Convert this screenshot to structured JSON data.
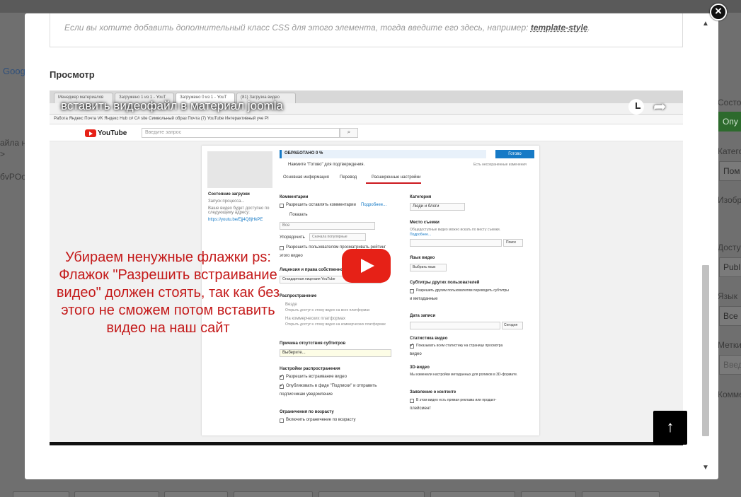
{
  "background": {
    "left_texts": [
      "Goog",
      "айла н",
      ">",
      "бvPOow"
    ],
    "right_labels": [
      "Состо",
      "Катего",
      "Изобра",
      "Досту",
      "Язык",
      "Метки",
      "Комме"
    ],
    "right_boxes": [
      "Пом",
      "Publ",
      "Все",
      "Введ"
    ],
    "green_label": "Опу"
  },
  "modal": {
    "close_symbol": "×",
    "hint_text": "Если вы хотите добавить дополнительный класс CSS для этого элемента, тогда введите его здесь, например:",
    "hint_example": "template-style",
    "hint_end": ".",
    "preview_label": "Просмотр",
    "scroll_up": "▲",
    "scroll_down": "▼",
    "scroll_top_symbol": "↑"
  },
  "video": {
    "title": "вставить видеофайл в материал joomla",
    "share_symbol": "➦",
    "overlay_text": "Убираем ненужные флажки ps: Флажок \"Разрешить встраивание видео\" должен стоять, так как без этого не сможем потом вставить видео на наш сайт",
    "browser_tabs": [
      "Менеджер материалов",
      "Загружено 1 из 1 - YouT",
      "Загружено 0 из 1 - YouT",
      "(81) Загрузка видео"
    ],
    "bookmarks": "Работа   Яндекс   Почта   VK   Яндекс   Hub   c#   C# site   Символьный образ   Почта   (7) YouTube   Интерактивный уче   PI",
    "yt": {
      "logo_text": "YouTube",
      "search_placeholder": "Введите запрос",
      "search_btn": "⌕",
      "progress_label": "ОБРАБОТАНО 0 %",
      "done_btn": "Готово",
      "notice": "Нажмите \"Готово\" для подтверждения.",
      "unsaved": "Есть несохраненные изменения",
      "tabs": [
        "Основная информация",
        "Перевод",
        "Расширенные настройки"
      ],
      "upload_status": "Состояние загрузки",
      "upload_start": "Запуск процесса...",
      "available_text": "Ваше видео будет доступно по следующему адресу:",
      "url": "https://youtu.be/Ejj4Q8jHkPE",
      "comments": "Комментарии",
      "allow_comments": "Разрешить оставлять комментарии",
      "more": "Подробнее...",
      "show": "Показать",
      "show_value": "Все",
      "order": "Упорядочить",
      "order_value": "Сначала популярные",
      "allow_ratings": "Разрешить пользователям просматривать рейтинг",
      "this_video": "этого видео",
      "license": "Лицензия и права собственности",
      "license_value": "Стандартная лицензия YouTube",
      "distribution": "Распространение",
      "everywhere": "Везде",
      "everywhere_sub": "Открыть доступ к этому видео на всех платформах",
      "noncommercial": "На коммерческих платформах",
      "noncommercial_sub": "Открыть доступ к этому видео на коммерческих платформах",
      "subtitles_reason": "Причина отсутствия субтитров",
      "choose": "Выберите...",
      "dist_settings": "Настройки распространения",
      "allow_embed": "Разрешить встраивание видео",
      "publish_feed": "Опубликовать в фиде \"Подписки\" и отправить",
      "notify_subs": "подписчикам уведомление",
      "age_restrict": "Ограничения по возрасту",
      "enable_age": "Включить ограничение по возрасту",
      "category": "Категория",
      "category_value": "Люди и блоги",
      "location": "Место съемки",
      "location_sub": "Общедоступные видео можно искать по месту съемки.",
      "search_btn2": "Поиск",
      "language": "Язык видео",
      "language_value": "Выбрать язык",
      "other_subs": "Субтитры других пользователей",
      "allow_translate": "Разрешить другим пользователям переводить субтитры",
      "and_meta": "и метаданные",
      "record_date": "Дата записи",
      "today": "Сегодня",
      "stats": "Статистика видео",
      "show_stats": "Показывать всем статистику на странице просмотра",
      "video_word": "видео",
      "video3d": "3D-видео",
      "video3d_sub": "Мы изменили настройки метаданных для роликов в 3D-формате.",
      "content_claim": "Заявление о контенте",
      "promo": "В этом видео есть прямая реклама или продакт-",
      "placement": "плейсмент"
    }
  }
}
